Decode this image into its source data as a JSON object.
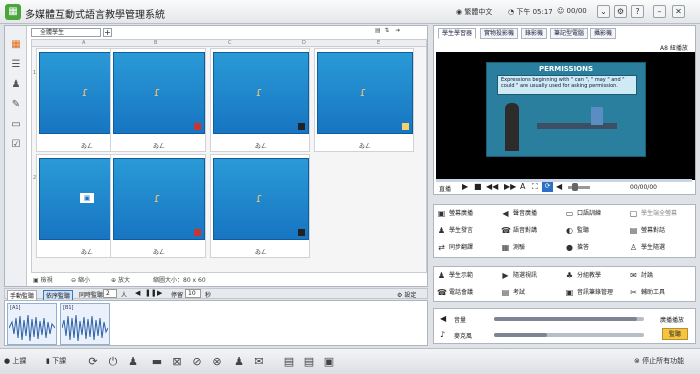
{
  "app": {
    "title": "多媒體互動式語言教學管理系統"
  },
  "titlebar": {
    "language": "繁體中文",
    "clock_prefix": "下午",
    "time": "05:17",
    "counter": "00/00"
  },
  "left": {
    "sheet_tab": "全體學生",
    "column_headers": [
      "A",
      "B",
      "C",
      "D",
      "E"
    ],
    "row_headers": [
      "1",
      "2"
    ],
    "cells": [
      {
        "caption": "ゐㄥ"
      },
      {
        "caption": "ゐㄥ"
      },
      {
        "caption": "ゐㄥ"
      },
      {
        "caption": "ゐㄥ"
      },
      {
        "caption": "ゐㄥ"
      },
      {
        "caption": "ゐㄥ"
      },
      {
        "caption": "ゐㄥ"
      }
    ],
    "status": {
      "toggle": "檢視",
      "zoom_out": "縮小",
      "zoom_in": "放大",
      "size": "縮圖大小：80 x 60"
    },
    "bottom": {
      "tab1": "手動監聽",
      "tab2": "依序監聽",
      "interval_label": "同時監聽",
      "interval_value": "2",
      "interval_unit": "人",
      "stop_label": "停留",
      "stop_value": "10",
      "stop_unit": "秒",
      "settings": "設定"
    },
    "waves": [
      {
        "label": "[A1]"
      },
      {
        "label": "[B1]"
      }
    ]
  },
  "right": {
    "tabs": [
      "學生學習器",
      "實物投影機",
      "錄影機",
      "筆記型電腦",
      "攝影機"
    ],
    "video_label": "A8 紐播放",
    "slide_title": "PERMISSIONS",
    "slide_text": "Expressions beginning with \" can \", \" may \" and \" could \" are usually used for asking permission.",
    "controls": {
      "play_label": "直播",
      "time": "00/00/00"
    },
    "functions1": [
      "螢幕廣播",
      "聲音廣播",
      "口語訓練",
      "學生端全螢幕",
      "學生發言",
      "語音對講",
      "監聽",
      "螢幕對話",
      "同步翻譯",
      "測驗",
      "搶答",
      "學生隨選"
    ],
    "functions2": [
      "學生示範",
      "隨選視訊",
      "分組教學",
      "討論",
      "電話會議",
      "考試",
      "音訊筆錄管理",
      "輔助工具"
    ],
    "audio": {
      "volume_label": "音量",
      "volume_level": 0.95,
      "mute_label": "麥克風",
      "mic_level": 0.35,
      "right_label": "廣播播放",
      "monitor_label": "監聽"
    }
  },
  "bottom_toolbar": {
    "login": "上課",
    "logout": "下課",
    "stop_all": "停止所有功能"
  }
}
